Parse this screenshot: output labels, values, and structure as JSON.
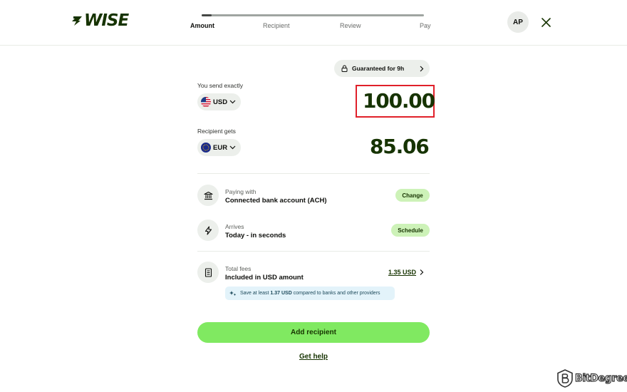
{
  "header": {
    "logo_text": "WISE",
    "steps": [
      {
        "label": "Amount",
        "active": true
      },
      {
        "label": "Recipient",
        "active": false
      },
      {
        "label": "Review",
        "active": false
      },
      {
        "label": "Pay",
        "active": false
      }
    ],
    "avatar_initials": "AP",
    "close_icon": "close-icon"
  },
  "quote": {
    "guarantee_label": "Guaranteed for 9h",
    "send": {
      "label": "You send exactly",
      "currency": "USD",
      "amount": "100.00"
    },
    "receive": {
      "label": "Recipient gets",
      "currency": "EUR",
      "amount": "85.06"
    }
  },
  "details": {
    "paying_with": {
      "label": "Paying with",
      "value": "Connected bank account (ACH)",
      "action": "Change",
      "icon": "bank-icon"
    },
    "arrives": {
      "label": "Arrives",
      "value": "Today - in seconds",
      "action": "Schedule",
      "icon": "lightning-icon"
    },
    "fees": {
      "label": "Total fees",
      "value": "Included in USD amount",
      "amount": "1.35 USD",
      "icon": "receipt-icon",
      "savings_prefix": "Save at least",
      "savings_amount": "1.37 USD",
      "savings_suffix": "compared to banks and other providers"
    }
  },
  "actions": {
    "primary": "Add recipient",
    "help": "Get help"
  },
  "watermark": {
    "text": "BitDegree"
  },
  "colors": {
    "brand_dark": "#163300",
    "brand_green": "#80e961",
    "chip_green": "#cdf2b8",
    "highlight_red": "#e0202a"
  }
}
